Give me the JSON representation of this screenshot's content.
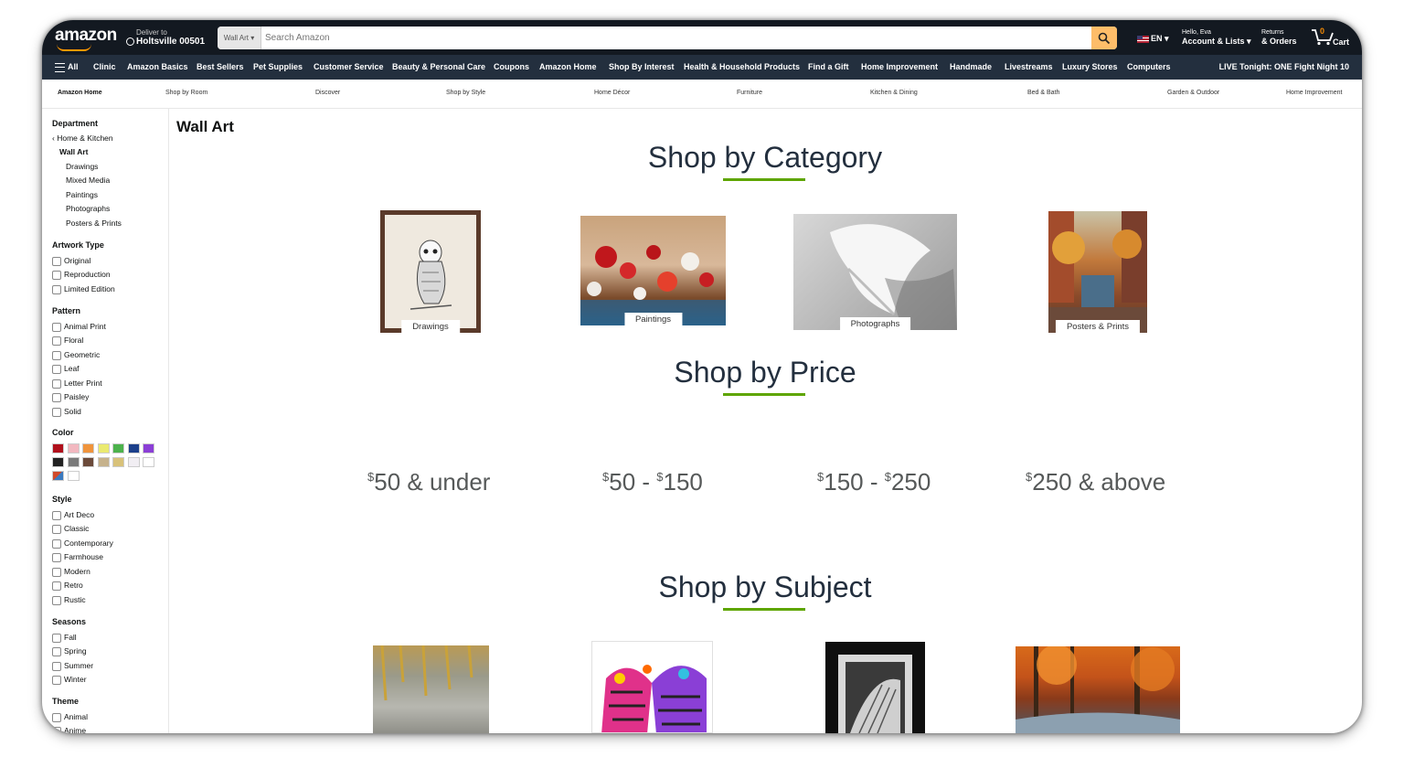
{
  "header": {
    "logo": "amazon",
    "deliver_to_label": "Deliver to",
    "deliver_location": "Holtsville 00501",
    "search_category": "Wall Art",
    "search_placeholder": "Search Amazon",
    "language": "EN",
    "account_greeting": "Hello, Eva",
    "account_label": "Account & Lists",
    "returns_label": "Returns",
    "orders_label": "& Orders",
    "cart_count": "0",
    "cart_label": "Cart"
  },
  "main_nav": {
    "all_label": "All",
    "items": [
      "Clinic",
      "Amazon Basics",
      "Best Sellers",
      "Pet Supplies",
      "Customer Service",
      "Beauty & Personal Care",
      "Coupons",
      "Amazon Home",
      "Shop By Interest",
      "Health & Household Products",
      "Find a Gift",
      "Home Improvement",
      "Handmade",
      "Livestreams",
      "Luxury Stores",
      "Computers"
    ],
    "promo": "LIVE Tonight: ONE Fight Night 10"
  },
  "sub_nav": {
    "items": [
      "Amazon Home",
      "Shop by Room",
      "Discover",
      "Shop by Style",
      "Home Décor",
      "Furniture",
      "Kitchen & Dining",
      "Bed & Bath",
      "Garden & Outdoor",
      "Home Improvement"
    ]
  },
  "sidebar": {
    "department_heading": "Department",
    "department_back": "Home & Kitchen",
    "department_current": "Wall Art",
    "department_items": [
      "Drawings",
      "Mixed Media",
      "Paintings",
      "Photographs",
      "Posters & Prints"
    ],
    "artwork_type": {
      "heading": "Artwork Type",
      "options": [
        "Original",
        "Reproduction",
        "Limited Edition"
      ]
    },
    "pattern": {
      "heading": "Pattern",
      "options": [
        "Animal Print",
        "Floral",
        "Geometric",
        "Leaf",
        "Letter Print",
        "Paisley",
        "Solid"
      ]
    },
    "color": {
      "heading": "Color",
      "swatches": [
        "#b0101c",
        "#f2b8c0",
        "#f0943c",
        "#eaea70",
        "#4cb24c",
        "#1c3f8a",
        "#8b3fd6",
        "#222222",
        "#7a7a7a",
        "#6b4a3a",
        "#c6b28c",
        "#d8c27a",
        "#f1eef3",
        "#ffffff",
        "#multi",
        "#ffffff"
      ]
    },
    "style": {
      "heading": "Style",
      "options": [
        "Art Deco",
        "Classic",
        "Contemporary",
        "Farmhouse",
        "Modern",
        "Retro",
        "Rustic"
      ]
    },
    "seasons": {
      "heading": "Seasons",
      "options": [
        "Fall",
        "Spring",
        "Summer",
        "Winter"
      ]
    },
    "theme": {
      "heading": "Theme",
      "options": [
        "Animal",
        "Anime"
      ]
    }
  },
  "main": {
    "page_title": "Wall Art",
    "shop_by_category": {
      "heading": "Shop by Category",
      "tiles": [
        "Drawings",
        "Paintings",
        "Photographs",
        "Posters & Prints"
      ]
    },
    "shop_by_price": {
      "heading": "Shop by Price",
      "ranges": [
        {
          "a": "$",
          "b": "50 & under"
        },
        {
          "a": "$",
          "b": "50 - ",
          "c": "$",
          "d": "150"
        },
        {
          "a": "$",
          "b": "150 - ",
          "c": "$",
          "d": "250"
        },
        {
          "a": "$",
          "b": "250 & above"
        }
      ]
    },
    "shop_by_subject": {
      "heading": "Shop by Subject"
    }
  },
  "colors": {
    "nav_dark": "#131921",
    "nav_mid": "#232f3e",
    "search_button": "#febd69",
    "accent_underline": "#5ea500",
    "cart_count": "#f08804"
  }
}
